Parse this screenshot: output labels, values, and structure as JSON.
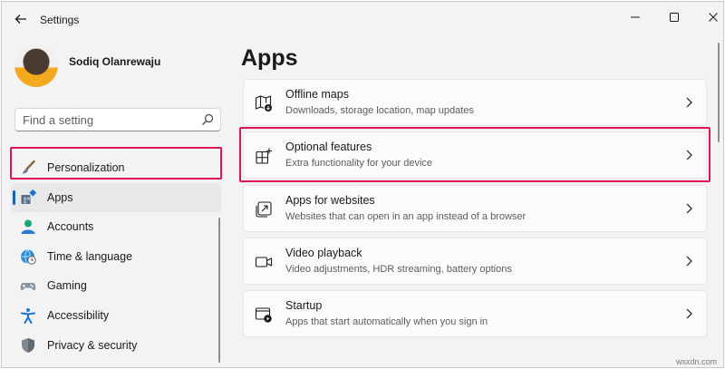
{
  "window": {
    "title": "Settings",
    "controls": [
      "minimize-icon",
      "maximize-icon",
      "close-icon"
    ]
  },
  "user": {
    "name": "Sodiq Olanrewaju"
  },
  "search": {
    "placeholder": "Find a setting",
    "value": ""
  },
  "sidebar": {
    "items": [
      {
        "label": "Personalization",
        "icon": "paintbrush-icon",
        "active": false
      },
      {
        "label": "Apps",
        "icon": "apps-icon",
        "active": true
      },
      {
        "label": "Accounts",
        "icon": "person-icon",
        "active": false
      },
      {
        "label": "Time & language",
        "icon": "globe-clock-icon",
        "active": false
      },
      {
        "label": "Gaming",
        "icon": "gamepad-icon",
        "active": false
      },
      {
        "label": "Accessibility",
        "icon": "accessibility-icon",
        "active": false
      },
      {
        "label": "Privacy & security",
        "icon": "shield-icon",
        "active": false
      }
    ]
  },
  "main": {
    "title": "Apps",
    "cards": [
      {
        "title": "Offline maps",
        "subtitle": "Downloads, storage location, map updates",
        "icon": "map-download-icon"
      },
      {
        "title": "Optional features",
        "subtitle": "Extra functionality for your device",
        "icon": "add-grid-icon"
      },
      {
        "title": "Apps for websites",
        "subtitle": "Websites that can open in an app instead of a browser",
        "icon": "open-in-app-icon"
      },
      {
        "title": "Video playback",
        "subtitle": "Video adjustments, HDR streaming, battery options",
        "icon": "video-camera-icon"
      },
      {
        "title": "Startup",
        "subtitle": "Apps that start automatically when you sign in",
        "icon": "startup-icon"
      }
    ]
  },
  "colors": {
    "highlight": "#e0135a",
    "accent": "#1a5fb4",
    "background": "#f3f3f3",
    "card": "#fbfbfb"
  },
  "watermark": "wsxdn.com"
}
